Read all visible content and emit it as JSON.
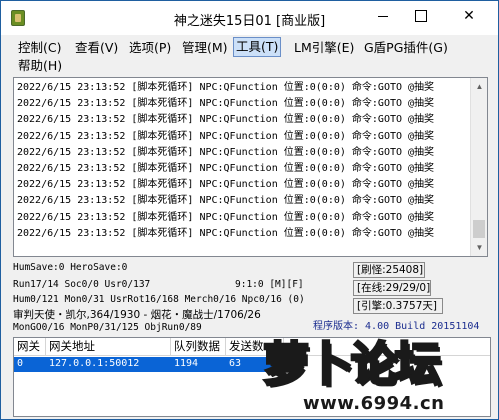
{
  "window": {
    "title": "神之迷失15日01 [商业版]",
    "close_glyph": "✕"
  },
  "menu": {
    "items": [
      {
        "label": "控制(C)"
      },
      {
        "label": "查看(V)"
      },
      {
        "label": "选项(P)"
      },
      {
        "label": "管理(M)"
      },
      {
        "label": "工具(T)",
        "active": true
      },
      {
        "label": "LM引擎(E)"
      },
      {
        "label": "G盾PG插件(G)"
      },
      {
        "label": "帮助(H)"
      }
    ]
  },
  "log": {
    "lines": [
      "2022/6/15 23:13:52 [脚本死循环] NPC:QFunction 位置:0(0:0) 命令:GOTO @抽奖",
      "2022/6/15 23:13:52 [脚本死循环] NPC:QFunction 位置:0(0:0) 命令:GOTO @抽奖",
      "2022/6/15 23:13:52 [脚本死循环] NPC:QFunction 位置:0(0:0) 命令:GOTO @抽奖",
      "2022/6/15 23:13:52 [脚本死循环] NPC:QFunction 位置:0(0:0) 命令:GOTO @抽奖",
      "2022/6/15 23:13:52 [脚本死循环] NPC:QFunction 位置:0(0:0) 命令:GOTO @抽奖",
      "2022/6/15 23:13:52 [脚本死循环] NPC:QFunction 位置:0(0:0) 命令:GOTO @抽奖",
      "2022/6/15 23:13:52 [脚本死循环] NPC:QFunction 位置:0(0:0) 命令:GOTO @抽奖",
      "2022/6/15 23:13:52 [脚本死循环] NPC:QFunction 位置:0(0:0) 命令:GOTO @抽奖",
      "2022/6/15 23:13:52 [脚本死循环] NPC:QFunction 位置:0(0:0) 命令:GOTO @抽奖",
      "2022/6/15 23:13:52 [脚本死循环] NPC:QFunction 位置:0(0:0) 命令:GOTO @抽奖"
    ]
  },
  "status": {
    "hum_save": "HumSave:0 HeroSave:0",
    "run": "Run17/14 Soc0/0 Usr0/137",
    "time": "9:1:0 [M][F]",
    "hum": "Hum0/121 Mon0/31 UsrRot16/168 Merch0/16 Npc0/16 (0)",
    "judge": "审判天使・凯尔,364/1930 - 烟花・魔战士/1706/26",
    "mon_go": "MonGO0/16 MonP0/31/125 ObjRun0/89",
    "refresh": "[刷怪:25408]",
    "online": "[在线:29/29/0]",
    "engine": "[引擎:0.3757天]",
    "version": "程序版本: 4.00 Build 20151104"
  },
  "grid": {
    "columns": [
      "网关",
      "网关地址",
      "队列数据",
      "发送数"
    ],
    "rows": [
      {
        "gate": "0",
        "address": "127.0.0.1:50012",
        "queue": "1194",
        "sent": "63"
      }
    ]
  },
  "watermark": {
    "chars": [
      "萝",
      "卜",
      "论",
      "坛"
    ],
    "url": "www.6994.cn"
  }
}
